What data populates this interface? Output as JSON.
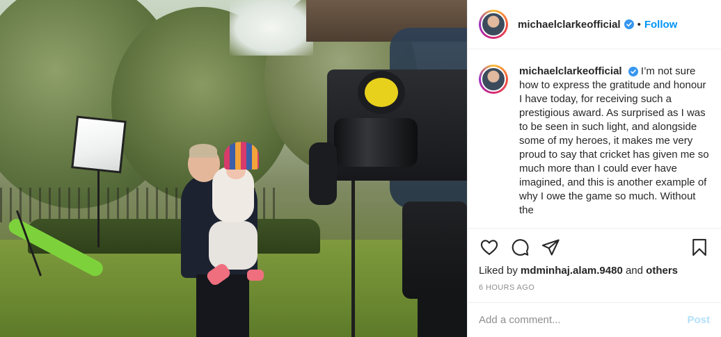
{
  "header": {
    "username": "michaelclarkeofficial",
    "dot": "•",
    "follow_label": "Follow"
  },
  "caption": {
    "username": "michaelclarkeofficial",
    "text": "I’m not sure how to express the gratitude and honour I have today, for receiving such a prestigious award. As surprised as I was to be seen in such light, and alongside some of my heroes, it makes me very proud to say that cricket has given me so much more than I could ever have imagined, and this is another example of why I owe the game so much. Without the"
  },
  "actions": {
    "icons": [
      "heart-icon",
      "comment-icon",
      "share-icon",
      "bookmark-icon"
    ]
  },
  "likes": {
    "prefix": "Liked by",
    "user": "mdminhaj.alam.9480",
    "connector": "and",
    "others": "others"
  },
  "timestamp": "6 HOURS AGO",
  "comment": {
    "placeholder": "Add a comment...",
    "post_label": "Post"
  },
  "colors": {
    "link_blue": "#0095f6",
    "verified_blue": "#3897f0",
    "post_disabled": "#b2dffc",
    "muted": "#8e8e8e"
  }
}
